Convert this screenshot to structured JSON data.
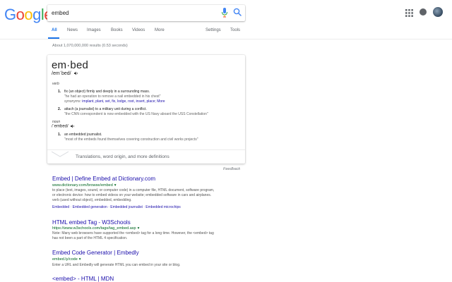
{
  "logo": {
    "letters": [
      "G",
      "o",
      "o",
      "g",
      "l",
      "e"
    ]
  },
  "search": {
    "query": "embed"
  },
  "tabs": [
    {
      "label": "All",
      "active": true
    },
    {
      "label": "News"
    },
    {
      "label": "Images"
    },
    {
      "label": "Books"
    },
    {
      "label": "Videos"
    },
    {
      "label": "More"
    },
    {
      "label": "Settings"
    },
    {
      "label": "Tools"
    }
  ],
  "stats": "About 1,070,000,000 results (0.53 seconds)",
  "dictionary": {
    "word": "em·bed",
    "phonetic": "/emˈbed/",
    "verb_label": "verb",
    "verb_defs": [
      {
        "num": "1.",
        "def": "fix (an object) firmly and deeply in a surrounding mass.",
        "example": "\"he had an operation to remove a nail embedded in his chest\"",
        "synonyms_label": "synonyms:",
        "synonyms": "implant, plant, set, fix, lodge, root, insert, place;",
        "more": "More"
      },
      {
        "num": "2.",
        "def": "attach (a journalist) to a military unit during a conflict.",
        "example": "\"the CNN correspondent is now embedded with the US Navy aboard the USS Constellation\""
      }
    ],
    "noun_label": "noun",
    "noun_phonetic": "/ˈembed/",
    "noun_defs": [
      {
        "num": "1.",
        "def": "an embedded journalist.",
        "example": "\"most of the embeds found themselves covering construction and civil works projects\""
      }
    ],
    "more_defs": "Translations, word origin, and more definitions"
  },
  "feedback": "Feedback",
  "results": [
    {
      "title": "Embed | Define Embed at Dictionary.com",
      "url": "www.dictionary.com/browse/embed",
      "snippet": [
        "to place (text, images, sound, or computer code) in a computer file, HTML document, software program,",
        "or electronic device: how to embed videos on your website; embedded software in cars and airplanes.",
        "verb (used without object), embedded, embedding."
      ],
      "links": "Embedded · Embedded generation · Embedded journalist · Embedded microchips"
    },
    {
      "title": "HTML embed Tag - W3Schools",
      "url": "https://www.w3schools.com/tags/tag_embed.asp",
      "snippet": [
        "Note: Many web browsers have supported the <embed> tag for a long time. However, the <embed> tag",
        "has not been a part of the HTML 4 specification."
      ]
    },
    {
      "title": "Embed Code Generator | Embedly",
      "url": "embed.ly/code",
      "snippet": [
        "Enter a URL and Embedly will generate HTML you can embed in your site or blog."
      ]
    },
    {
      "title": "<embed> - HTML | MDN",
      "url": "",
      "snippet": []
    }
  ],
  "colors": {
    "link": "#1a0dab",
    "url": "#006621",
    "accent": "#1a73e8"
  }
}
